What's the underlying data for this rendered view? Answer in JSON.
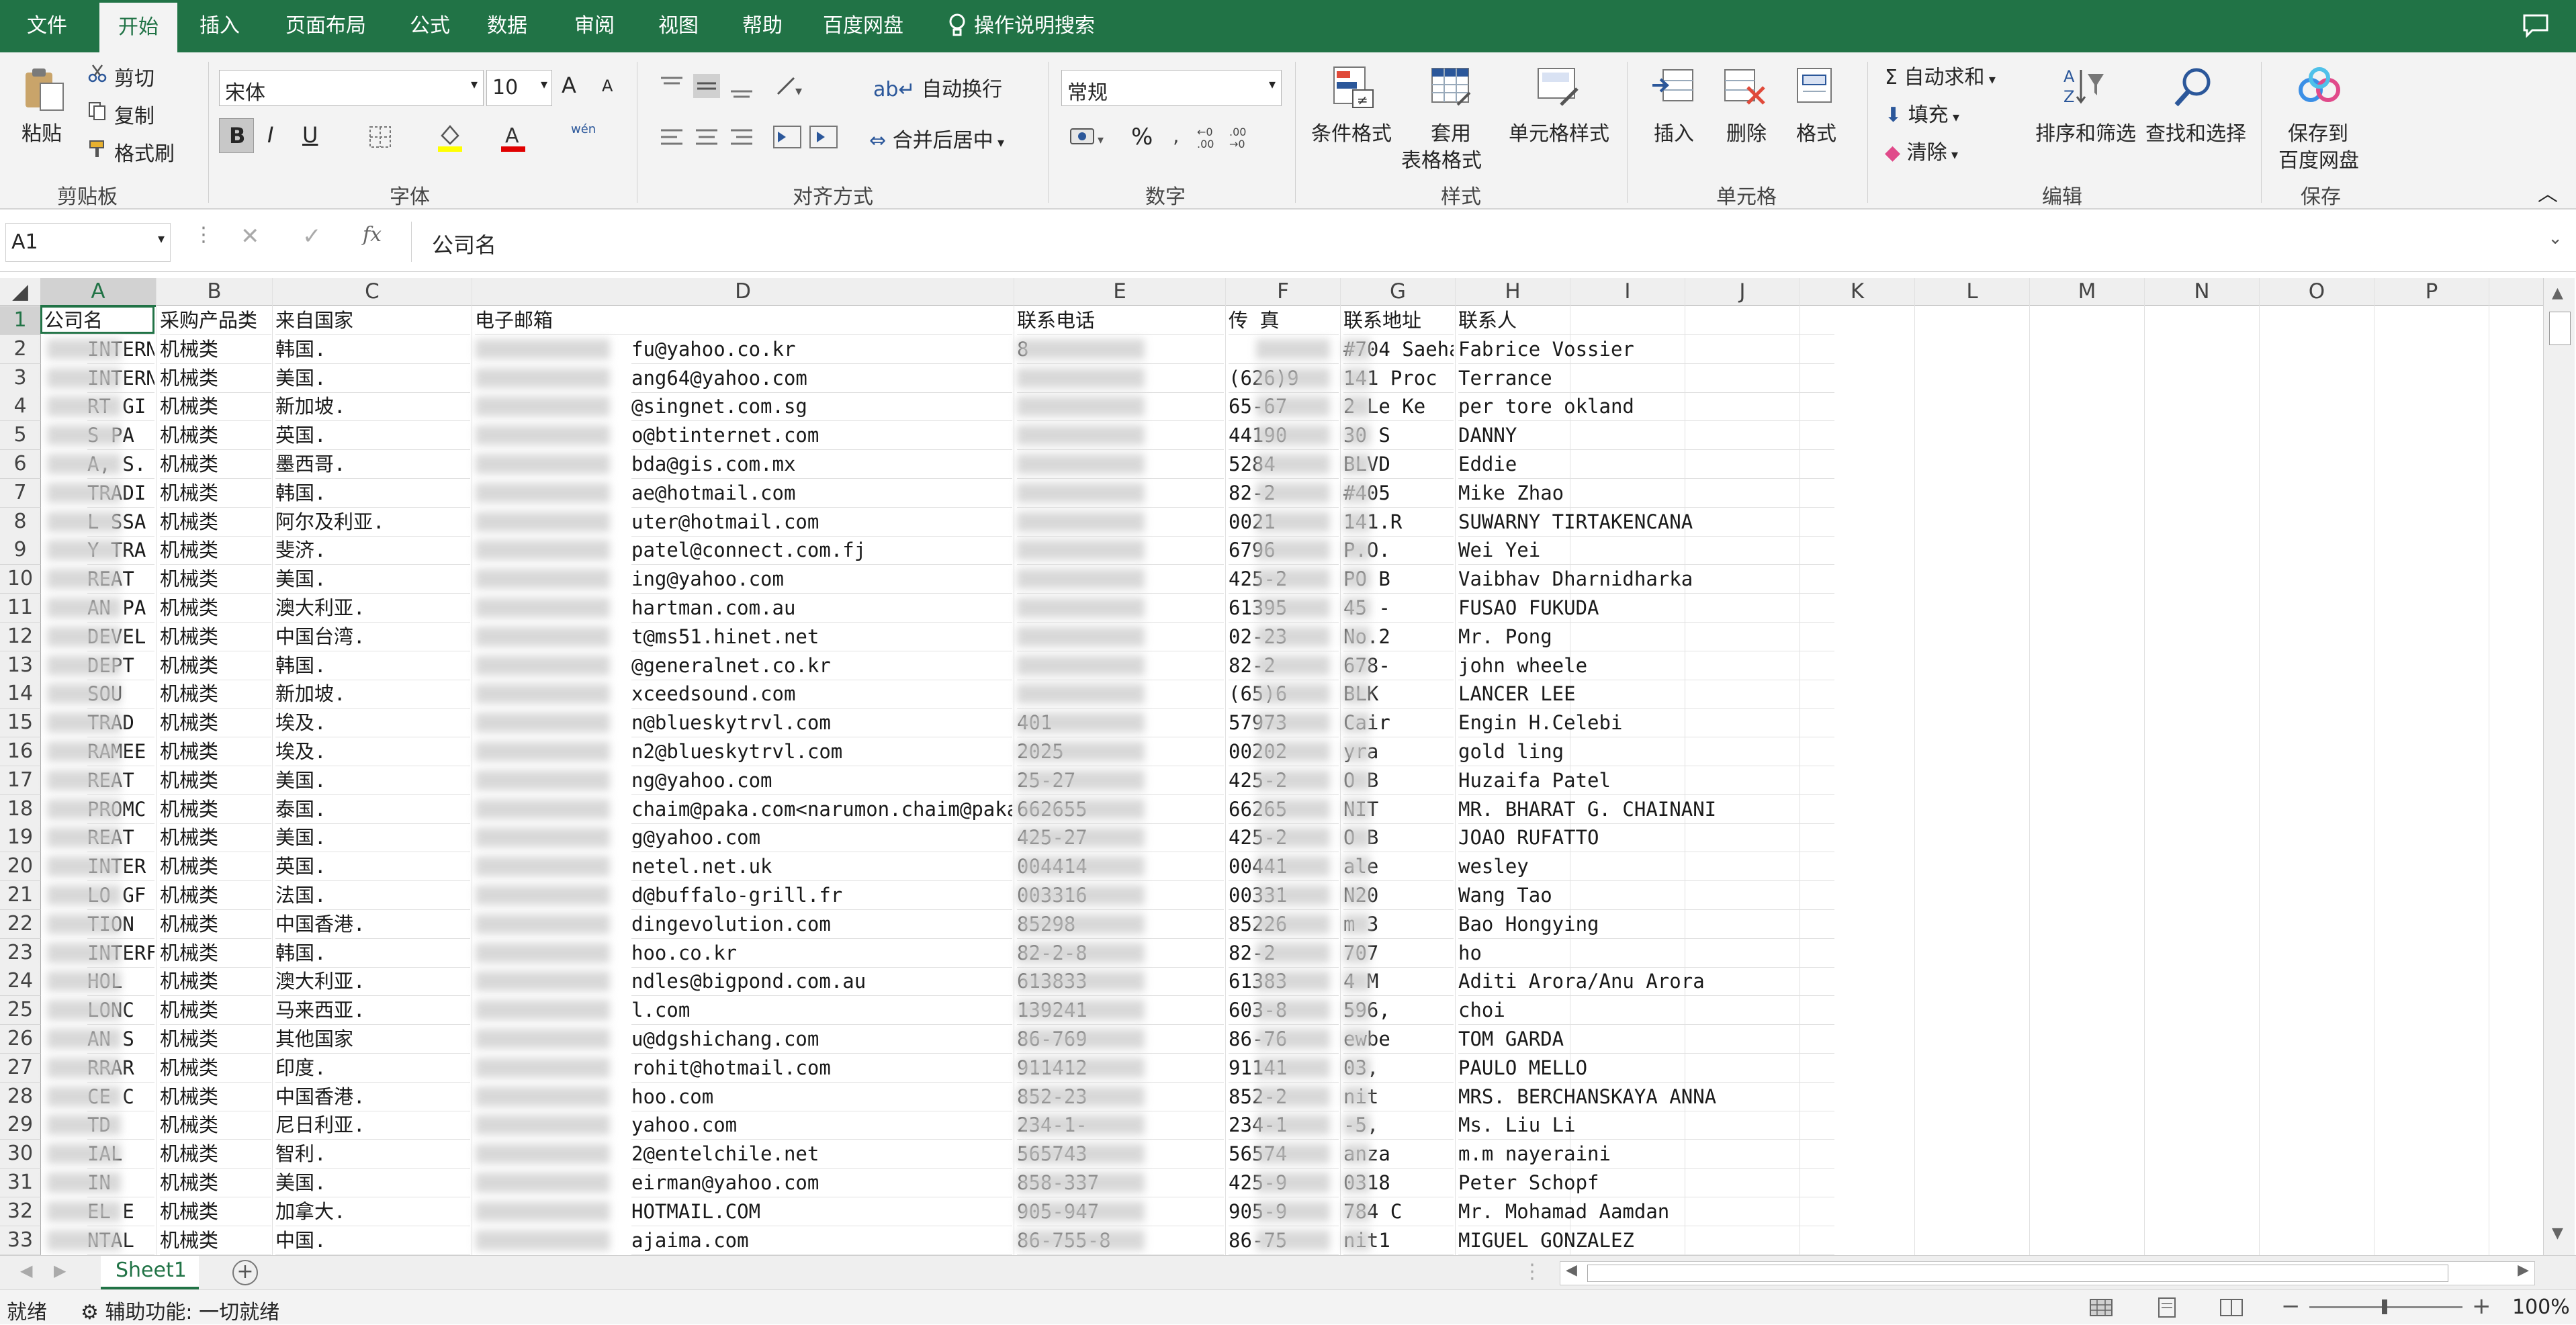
{
  "tabs": [
    "文件",
    "开始",
    "插入",
    "页面布局",
    "公式",
    "数据",
    "审阅",
    "视图",
    "帮助",
    "百度网盘",
    "操作说明搜索"
  ],
  "ribbon": {
    "clipboard": {
      "paste": "粘贴",
      "cut": "剪切",
      "copy": "复制",
      "format_painter": "格式刷",
      "group": "剪贴板"
    },
    "font": {
      "name": "宋体",
      "size": "10",
      "grow": "A",
      "shrink": "A",
      "bold": "B",
      "italic": "I",
      "underline": "U",
      "phonetic": "wén",
      "group": "字体"
    },
    "align": {
      "wrap": "自动换行",
      "merge": "合并后居中",
      "group": "对齐方式"
    },
    "number": {
      "format": "常规",
      "percent": "%",
      "group": "数字"
    },
    "styles": {
      "cond": "条件格式",
      "table1": "套用",
      "table2": "表格格式",
      "cell": "单元格样式",
      "group": "样式"
    },
    "cells": {
      "insert": "插入",
      "delete": "删除",
      "format": "格式",
      "group": "单元格"
    },
    "editing": {
      "autosum": "自动求和",
      "fill": "填充",
      "clear": "清除",
      "sort": "排序和筛选",
      "find": "查找和选择",
      "group": "编辑"
    },
    "save": {
      "l1": "保存到",
      "l2": "百度网盘",
      "group": "保存"
    }
  },
  "formula_bar": {
    "name_box": "A1",
    "fx": "fx",
    "value": "公司名"
  },
  "columns": [
    "A",
    "B",
    "C",
    "D",
    "E",
    "F",
    "G",
    "H",
    "I",
    "J",
    "K",
    "L",
    "M",
    "N",
    "O",
    "P"
  ],
  "header_row": [
    "公司名",
    "采购产品类",
    "来自国家",
    "电子邮箱",
    "联系电话",
    "传    真",
    "联系地址",
    "联系人"
  ],
  "rows": [
    {
      "n": "2",
      "a": "INTERN",
      "b": "机械类",
      "c": "韩国.",
      "d": "fu@yahoo.co.kr",
      "e": "8",
      "f": "",
      "g": "#704 Saeha",
      "h": "Fabrice Vossier"
    },
    {
      "n": "3",
      "a": "INTERN",
      "b": "机械类",
      "c": "美国.",
      "d": "ang64@yahoo.com",
      "e": "",
      "f": "(626)9",
      "g": "141 Proc",
      "h": "Terrance"
    },
    {
      "n": "4",
      "a": "RT GI",
      "b": "机械类",
      "c": "新加坡.",
      "d": "@singnet.com.sg",
      "e": "",
      "f": "65-67",
      "g": "2 Le Ke",
      "h": "per tore okland"
    },
    {
      "n": "5",
      "a": "S PA",
      "b": "机械类",
      "c": "英国.",
      "d": "o@btinternet.com",
      "e": "",
      "f": "44190",
      "g": "30 S",
      "h": "DANNY"
    },
    {
      "n": "6",
      "a": "A, S.",
      "b": "机械类",
      "c": "墨西哥.",
      "d": "bda@gis.com.mx",
      "e": "",
      "f": "5284",
      "g": "BLVD",
      "h": "Eddie"
    },
    {
      "n": "7",
      "a": "TRADI",
      "b": "机械类",
      "c": "韩国.",
      "d": "ae@hotmail.com",
      "e": "",
      "f": "82-2",
      "g": "#405",
      "h": "Mike Zhao"
    },
    {
      "n": "8",
      "a": "L SSA",
      "b": "机械类",
      "c": "阿尔及利亚.",
      "d": "uter@hotmail.com",
      "e": "",
      "f": "0021",
      "g": "141.R",
      "h": "SUWARNY TIRTAKENCANA"
    },
    {
      "n": "9",
      "a": "Y TRA",
      "b": "机械类",
      "c": "斐济.",
      "d": "patel@connect.com.fj",
      "e": "",
      "f": "6796",
      "g": "P.O.",
      "h": "Wei Yei"
    },
    {
      "n": "10",
      "a": "REAT",
      "b": "机械类",
      "c": "美国.",
      "d": "ing@yahoo.com",
      "e": "",
      "f": "425-2",
      "g": "PO B",
      "h": "Vaibhav Dharnidharka"
    },
    {
      "n": "11",
      "a": "AN PA",
      "b": "机械类",
      "c": "澳大利亚.",
      "d": "hartman.com.au",
      "e": "",
      "f": "61395",
      "g": "45 -",
      "h": "FUSAO FUKUDA"
    },
    {
      "n": "12",
      "a": "DEVEL",
      "b": "机械类",
      "c": "中国台湾.",
      "d": "t@ms51.hinet.net",
      "e": "",
      "f": "02-23",
      "g": "No.2",
      "h": "Mr. Pong"
    },
    {
      "n": "13",
      "a": "DEPT",
      "b": "机械类",
      "c": "韩国.",
      "d": "@generalnet.co.kr",
      "e": "",
      "f": "82-2",
      "g": "678-",
      "h": "john wheele"
    },
    {
      "n": "14",
      "a": "SOU",
      "b": "机械类",
      "c": "新加坡.",
      "d": "xceedsound.com",
      "e": "",
      "f": "(65)6",
      "g": "BLK",
      "h": "LANCER LEE"
    },
    {
      "n": "15",
      "a": "TRAD",
      "b": "机械类",
      "c": "埃及.",
      "d": "n@blueskytrvl.com",
      "e": "401",
      "f": "57973",
      "g": "Cair",
      "h": "Engin H.Celebi"
    },
    {
      "n": "16",
      "a": "RAMEE",
      "b": "机械类",
      "c": "埃及.",
      "d": "n2@blueskytrvl.com",
      "e": "2025",
      "f": "00202",
      "g": "yra",
      "h": "gold ling"
    },
    {
      "n": "17",
      "a": "REAT",
      "b": "机械类",
      "c": "美国.",
      "d": "ng@yahoo.com",
      "e": "25-27",
      "f": "425-2",
      "g": "O B",
      "h": "Huzaifa Patel"
    },
    {
      "n": "18",
      "a": "PROMC",
      "b": "机械类",
      "c": "泰国.",
      "d": "chaim@paka.com<narumon.chaim@paka.com>",
      "e": "662655",
      "f": "66265",
      "g": "NIT",
      "h": "MR. BHARAT G. CHAINANI"
    },
    {
      "n": "19",
      "a": "REAT",
      "b": "机械类",
      "c": "美国.",
      "d": "g@yahoo.com",
      "e": "425-27",
      "f": "425-2",
      "g": "O B",
      "h": "JOAO RUFATTO"
    },
    {
      "n": "20",
      "a": "INTER",
      "b": "机械类",
      "c": "英国.",
      "d": "netel.net.uk",
      "e": "004414",
      "f": "00441",
      "g": "ale",
      "h": "wesley"
    },
    {
      "n": "21",
      "a": "LO GF",
      "b": "机械类",
      "c": "法国.",
      "d": "d@buffalo-grill.fr",
      "e": "003316",
      "f": "00331",
      "g": "N20",
      "h": "Wang Tao"
    },
    {
      "n": "22",
      "a": "TION",
      "b": "机械类",
      "c": "中国香港.",
      "d": "dingevolution.com",
      "e": "85298",
      "f": "85226",
      "g": "m 3",
      "h": "Bao Hongying"
    },
    {
      "n": "23",
      "a": "INTERF",
      "b": "机械类",
      "c": "韩国.",
      "d": "hoo.co.kr",
      "e": "82-2-8",
      "f": "82-2",
      "g": "707",
      "h": "ho"
    },
    {
      "n": "24",
      "a": "HOL",
      "b": "机械类",
      "c": "澳大利亚.",
      "d": "ndles@bigpond.com.au",
      "e": "613833",
      "f": "61383",
      "g": "4 M",
      "h": "Aditi Arora/Anu Arora"
    },
    {
      "n": "25",
      "a": "LONC",
      "b": "机械类",
      "c": "马来西亚.",
      "d": "l.com",
      "e": "139241",
      "f": "603-8",
      "g": "596,",
      "h": "choi"
    },
    {
      "n": "26",
      "a": "AN S",
      "b": "机械类",
      "c": "其他国家",
      "d": "u@dgshichang.com",
      "e": "86-769",
      "f": "86-76",
      "g": "ewbe",
      "h": "TOM GARDA"
    },
    {
      "n": "27",
      "a": "RRAR",
      "b": "机械类",
      "c": "印度.",
      "d": "rohit@hotmail.com",
      "e": "911412",
      "f": "91141",
      "g": "03,",
      "h": "PAULO MELLO"
    },
    {
      "n": "28",
      "a": "CE C",
      "b": "机械类",
      "c": "中国香港.",
      "d": "hoo.com",
      "e": "852-23",
      "f": "852-2",
      "g": "nit",
      "h": "MRS. BERCHANSKAYA ANNA"
    },
    {
      "n": "29",
      "a": "TD",
      "b": "机械类",
      "c": "尼日利亚.",
      "d": "yahoo.com",
      "e": "234-1-",
      "f": "234-1",
      "g": "-5,",
      "h": "Ms. Liu Li"
    },
    {
      "n": "30",
      "a": "IAL",
      "b": "机械类",
      "c": "智利.",
      "d": "2@entelchile.net",
      "e": "565743",
      "f": "56574",
      "g": "anza",
      "h": "m.m nayeraini"
    },
    {
      "n": "31",
      "a": "IN",
      "b": "机械类",
      "c": "美国.",
      "d": "eirman@yahoo.com",
      "e": "858-337",
      "f": "425-9",
      "g": "0318",
      "h": "Peter Schopf"
    },
    {
      "n": "32",
      "a": "EL E",
      "b": "机械类",
      "c": "加拿大.",
      "d": "HOTMAIL.COM",
      "e": "905-947",
      "f": "905-9",
      "g": "784 C",
      "h": "Mr. Mohamad Aamdan"
    },
    {
      "n": "33",
      "a": "NTAL",
      "b": "机械类",
      "c": "中国.",
      "d": "ajaima.com",
      "e": "86-755-8",
      "f": "86-75",
      "g": "nit1",
      "h": "MIGUEL GONZALEZ"
    }
  ],
  "sheet_tab": "Sheet1",
  "status": {
    "ready": "就绪",
    "accessibility": "辅助功能: 一切就绪",
    "zoom": "100%"
  }
}
